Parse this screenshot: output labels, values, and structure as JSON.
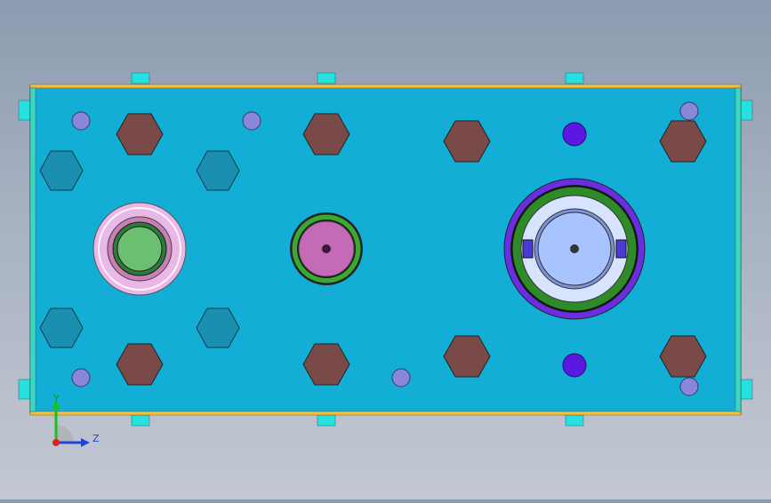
{
  "viewport": {
    "background_top": "#8d9bb0",
    "background_bottom": "#c3c8d2"
  },
  "model": {
    "plate_color": "#13aed6",
    "plate_edge_color": "#f0c040",
    "side_strip_color": "#3fd5c0",
    "bolt_head_color": "#7a4a48",
    "hex_boss_color": "#1a8fb0",
    "small_hole_color": "#8a86d8",
    "dowel_color": "#5a18e0",
    "tab_color": "#29e0e0",
    "left_bushing": {
      "outer": "#e9b8e6",
      "ring": "#c77fb6",
      "core": "#6ac070"
    },
    "center_bushing": {
      "ring": "#3aa832",
      "core": "#c46ab6"
    },
    "right_bushing": {
      "outer": "#6a2ee0",
      "ring": "#2f8a2a",
      "core": "#a8c4ff"
    }
  },
  "triad": {
    "y_label": "Y",
    "z_label": "Z",
    "y_color": "#19c219",
    "z_color": "#1e46d8",
    "origin_color": "#e02020"
  }
}
